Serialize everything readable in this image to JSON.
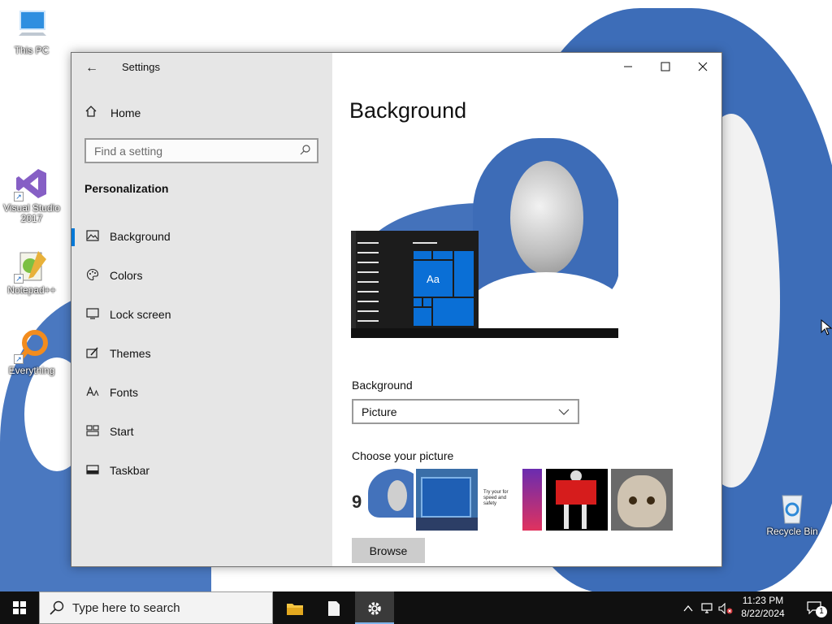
{
  "desktop": {
    "icons": [
      {
        "label": "This PC",
        "icon": "computer-icon"
      },
      {
        "label": "Visual Studio 2017",
        "icon": "visual-studio-icon"
      },
      {
        "label": "Notepad++",
        "icon": "notepad-plus-plus-icon"
      },
      {
        "label": "Everything",
        "icon": "everything-search-icon"
      },
      {
        "label": "Recycle Bin",
        "icon": "recycle-bin-icon"
      }
    ]
  },
  "window": {
    "title": "Settings",
    "caption": {
      "minimize": "─",
      "maximize": "☐",
      "close": "✕"
    }
  },
  "nav": {
    "back_glyph": "←",
    "home_label": "Home",
    "search_placeholder": "Find a setting",
    "section_title": "Personalization",
    "items": [
      {
        "label": "Background",
        "icon": "picture-icon",
        "active": true
      },
      {
        "label": "Colors",
        "icon": "palette-icon",
        "active": false
      },
      {
        "label": "Lock screen",
        "icon": "lock-screen-icon",
        "active": false
      },
      {
        "label": "Themes",
        "icon": "themes-icon",
        "active": false
      },
      {
        "label": "Fonts",
        "icon": "fonts-icon",
        "active": false
      },
      {
        "label": "Start",
        "icon": "start-icon",
        "active": false
      },
      {
        "label": "Taskbar",
        "icon": "taskbar-icon",
        "active": false
      }
    ]
  },
  "main": {
    "title": "Background",
    "preview_tile_text": "Aa",
    "background_label": "Background",
    "background_value": "Picture",
    "choose_label": "Choose your picture",
    "thumb_1_text": "9",
    "thumb_3_text": "Try your for speed and safety",
    "browse_label": "Browse"
  },
  "taskbar": {
    "search_placeholder": "Type here to search",
    "time": "11:23 PM",
    "date": "8/22/2024",
    "notification_count": "1"
  },
  "colors": {
    "accent": "#0078d7",
    "taskbar": "#101010",
    "nav_bg": "#e6e6e6"
  }
}
